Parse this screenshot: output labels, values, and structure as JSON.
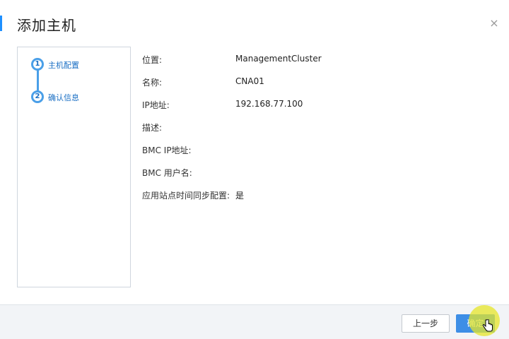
{
  "dialog": {
    "title": "添加主机",
    "close_symbol": "×"
  },
  "steps": [
    {
      "number": "1",
      "label": "主机配置"
    },
    {
      "number": "2",
      "label": "确认信息"
    }
  ],
  "info": [
    {
      "label": "位置:",
      "value": "ManagementCluster"
    },
    {
      "label": "名称:",
      "value": "CNA01"
    },
    {
      "label": "IP地址:",
      "value": "192.168.77.100"
    },
    {
      "label": "描述:",
      "value": ""
    },
    {
      "label": "BMC IP地址:",
      "value": ""
    },
    {
      "label": "BMC 用户名:",
      "value": ""
    },
    {
      "label": "应用站点时间同步配置:",
      "value": "是"
    }
  ],
  "footer": {
    "prev_label": "上一步",
    "ok_label": "确定"
  },
  "colors": {
    "accent": "#1e90ff",
    "step_blue": "#4a9fe8",
    "primary_button": "#3d8ee6",
    "cursor_highlight": "#e6e628"
  }
}
